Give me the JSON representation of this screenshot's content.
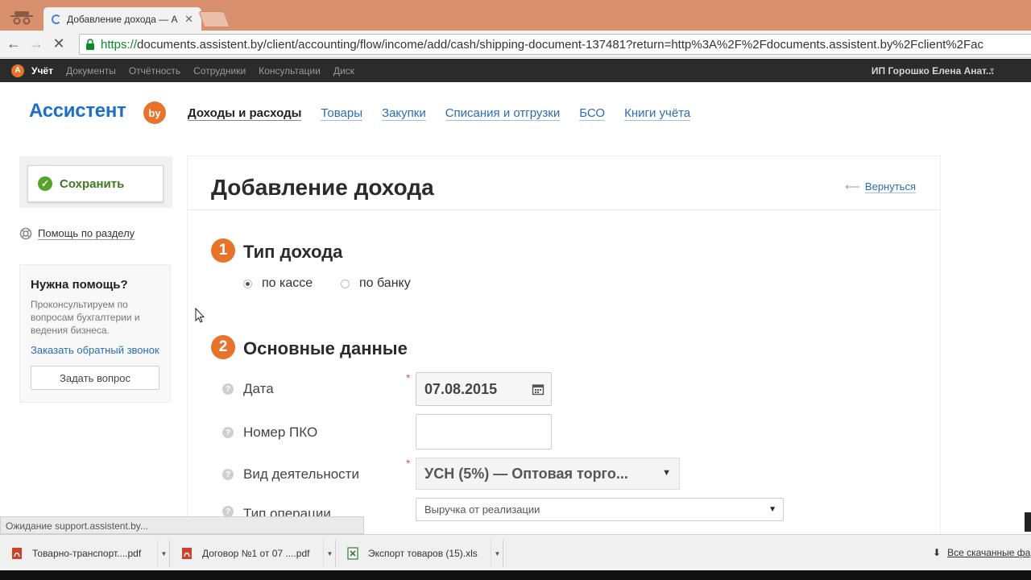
{
  "browser": {
    "tab_title": "Добавление дохода — А",
    "url_scheme": "https://",
    "url_rest": "documents.assistent.by/client/accounting/flow/income/add/cash/shipping-document-137481?return=http%3A%2F%2Fdocuments.assistent.by%2Fclient%2Fac",
    "status_text": "Ожидание support.assistent.by..."
  },
  "appnav": {
    "logo_letter": "A",
    "brand": "Учёт",
    "items": [
      "Документы",
      "Отчётность",
      "Сотрудники",
      "Консультации",
      "Диск"
    ],
    "user": "ИП Горошко Елена Анат..."
  },
  "site": {
    "logo_text": "Ассистент",
    "logo_badge": "by",
    "nav": [
      "Доходы и расходы",
      "Товары",
      "Закупки",
      "Списания и отгрузки",
      "БСО",
      "Книги учёта"
    ]
  },
  "sidebar": {
    "save_label": "Сохранить",
    "help_link": "Помощь по разделу",
    "help_box": {
      "title": "Нужна помощь?",
      "description": "Проконсультируем по вопросам бухгалтерии и ведения бизнеса.",
      "callback_link": "Заказать обратный звонок",
      "ask_button": "Задать вопрос"
    }
  },
  "form": {
    "title": "Добавление дохода",
    "back_link": "Вернуться",
    "section1": {
      "number": "1",
      "title": "Тип дохода",
      "options": [
        {
          "label": "по кассе",
          "selected": true
        },
        {
          "label": "по банку",
          "selected": false
        }
      ]
    },
    "section2": {
      "number": "2",
      "title": "Основные данные",
      "date_label": "Дата",
      "date_value": "07.08.2015",
      "pko_label": "Номер ПКО",
      "pko_value": "",
      "activity_label": "Вид деятельности",
      "activity_value": "УСН (5%) — Оптовая торго...",
      "optype_label": "Тип операции",
      "optype_value": "Выручка от реализации",
      "required_mark": "*"
    }
  },
  "downloads": {
    "items": [
      {
        "name": "Товарно-транспорт....pdf",
        "type": "pdf"
      },
      {
        "name": "Договор №1 от 07 ....pdf",
        "type": "pdf"
      },
      {
        "name": "Экспорт товаров (15).xls",
        "type": "xls"
      }
    ],
    "all_label": "Все скачанные фа"
  },
  "colors": {
    "accent_orange": "#e8742c",
    "link_blue": "#2a6db5",
    "save_green": "#55a42a",
    "tabbar": "#d8906f"
  }
}
